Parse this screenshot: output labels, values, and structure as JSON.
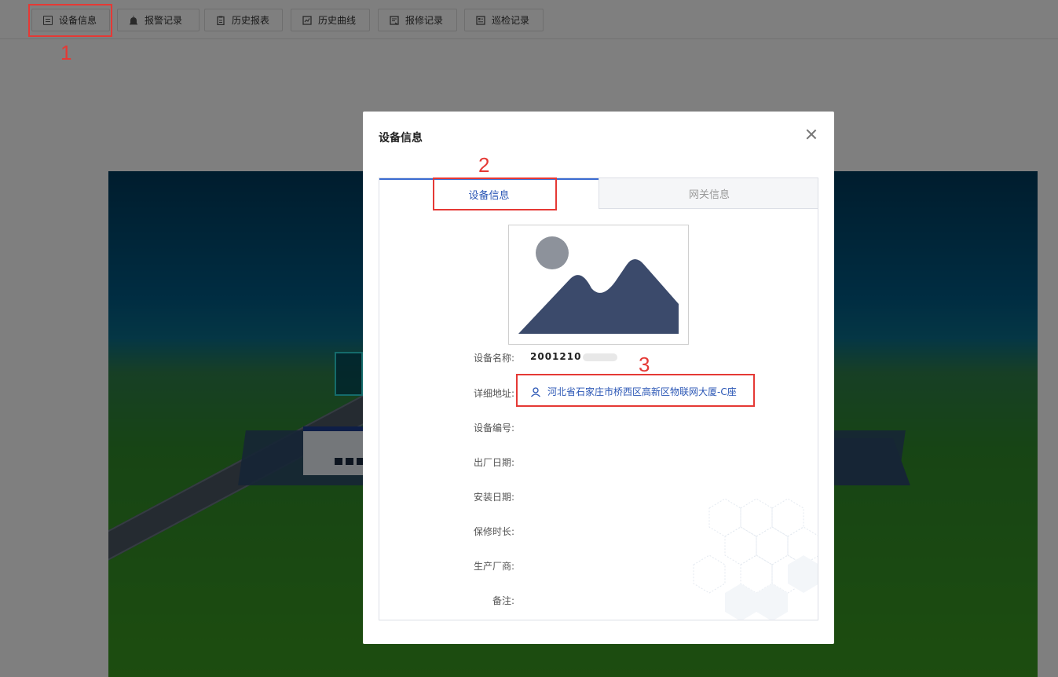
{
  "toolbar": {
    "buttons": [
      {
        "label": "设备信息",
        "icon": "device-info-icon"
      },
      {
        "label": "报警记录",
        "icon": "alarm-icon"
      },
      {
        "label": "历史报表",
        "icon": "report-icon"
      },
      {
        "label": "历史曲线",
        "icon": "chart-icon"
      },
      {
        "label": "报修记录",
        "icon": "repair-icon"
      },
      {
        "label": "巡检记录",
        "icon": "inspection-icon"
      }
    ]
  },
  "annotations": [
    "1",
    "2",
    "3"
  ],
  "modal": {
    "title": "设备信息",
    "tabs": [
      {
        "label": "设备信息",
        "active": true
      },
      {
        "label": "网关信息",
        "active": false
      }
    ],
    "fields": [
      {
        "label": "设备名称:",
        "value": "2001210"
      },
      {
        "label": "详细地址:",
        "value": "河北省石家庄市桥西区高新区物联网大厦-C座"
      },
      {
        "label": "设备编号:",
        "value": ""
      },
      {
        "label": "出厂日期:",
        "value": ""
      },
      {
        "label": "安装日期:",
        "value": ""
      },
      {
        "label": "保修时长:",
        "value": ""
      },
      {
        "label": "生产厂商:",
        "value": ""
      },
      {
        "label": "备注:",
        "value": ""
      }
    ]
  },
  "colors": {
    "accent": "#2a56b5",
    "annotation": "#e53935",
    "image_placeholder": "#3b4a6b"
  }
}
